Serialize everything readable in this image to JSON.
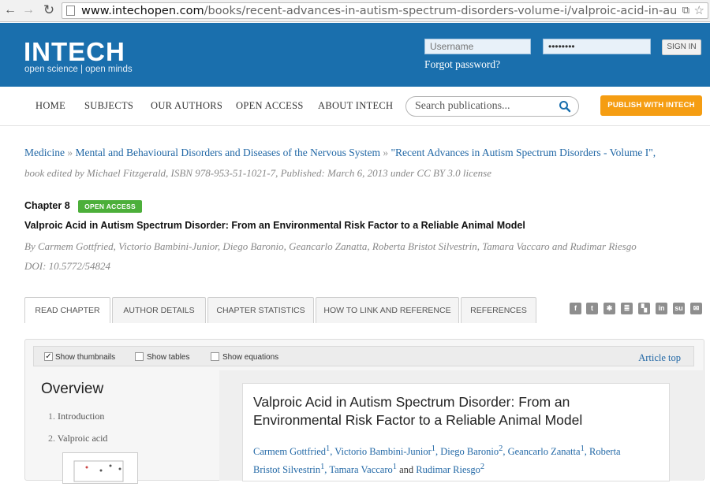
{
  "browser": {
    "url_host": "www.intechopen.com",
    "url_path": "/books/recent-advances-in-autism-spectrum-disorders-volume-i/valproic-acid-in-autism-spectru"
  },
  "header": {
    "logo": "INTECH",
    "tagline": "open science | open minds",
    "username_placeholder": "Username",
    "password_value": "••••••••",
    "signin_label": "SIGN IN",
    "forgot_label": "Forgot password?"
  },
  "nav": {
    "items": [
      "HOME",
      "SUBJECTS",
      "OUR AUTHORS",
      "OPEN ACCESS",
      "ABOUT INTECH"
    ],
    "search_placeholder": "Search publications...",
    "publish_label": "PUBLISH WITH INTECH"
  },
  "breadcrumb": {
    "items": [
      "Medicine",
      "Mental and Behavioural Disorders and Diseases of the Nervous System",
      "\"Recent Advances in Autism Spectrum Disorders - Volume I\","
    ],
    "separator": "»"
  },
  "book_meta": "book edited by Michael Fitzgerald, ISBN 978-953-51-1021-7, Published: March 6, 2013 under CC BY 3.0 license",
  "chapter": {
    "label": "Chapter 8",
    "badge": "OPEN ACCESS",
    "title": "Valproic Acid in Autism Spectrum Disorder: From an Environmental Risk Factor to a Reliable Animal Model",
    "authors": "By Carmem Gottfried, Victorio Bambini-Junior, Diego Baronio, Geancarlo Zanatta, Roberta Bristot Silvestrin, Tamara Vaccaro and Rudimar Riesgo",
    "doi": "DOI: 10.5772/54824"
  },
  "tabs": [
    "READ CHAPTER",
    "AUTHOR DETAILS",
    "CHAPTER STATISTICS",
    "HOW TO LINK AND REFERENCE",
    "REFERENCES"
  ],
  "social_icons": [
    "facebook-icon",
    "twitter-icon",
    "social-share-icon",
    "blogger-icon",
    "delicious-icon",
    "linkedin-icon",
    "stumbleupon-icon",
    "email-icon"
  ],
  "toolbar": {
    "show_thumbnails": "Show thumbnails",
    "show_tables": "Show tables",
    "show_equations": "Show equations",
    "article_top": "Article top"
  },
  "overview": {
    "title": "Overview",
    "items": [
      {
        "num": "1.",
        "label": "Introduction"
      },
      {
        "num": "2.",
        "label": "Valproic acid"
      }
    ]
  },
  "article": {
    "title": "Valproic Acid in Autism Spectrum Disorder: From an Environmental Risk Factor to a Reliable Animal Model",
    "authors": [
      {
        "name": "Carmem Gottfried",
        "sup": "1"
      },
      {
        "name": "Victorio Bambini-Junior",
        "sup": "1"
      },
      {
        "name": "Diego Baronio",
        "sup": "2"
      },
      {
        "name": "Geancarlo Zanatta",
        "sup": "1"
      },
      {
        "name": "Roberta Bristot Silvestrin",
        "sup": "1"
      },
      {
        "name": "Tamara Vaccaro",
        "sup": "1"
      },
      {
        "name": "Rudimar Riesgo",
        "sup": "2"
      }
    ],
    "author_connector": "and"
  }
}
